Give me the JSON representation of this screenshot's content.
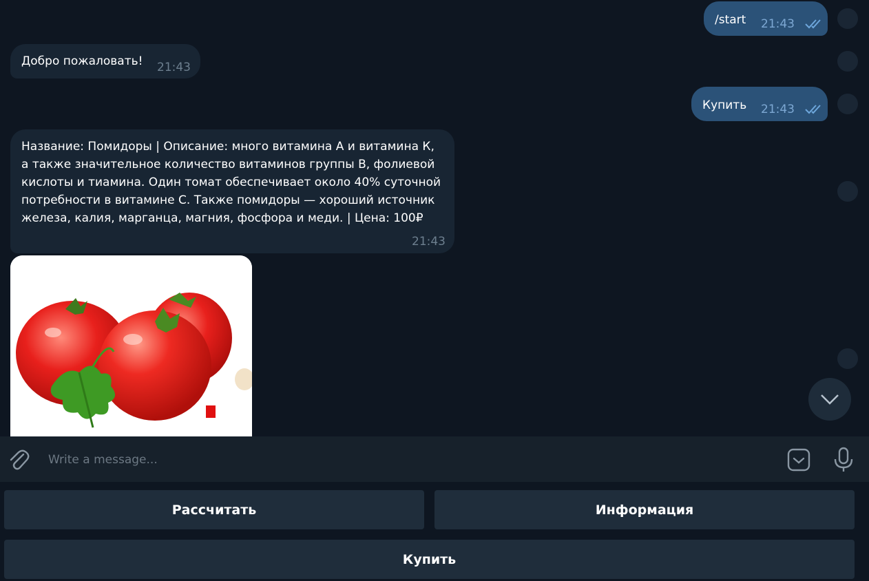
{
  "messages": [
    {
      "id": "start",
      "direction": "out",
      "text": "/start",
      "time": "21:43",
      "status": "read"
    },
    {
      "id": "welcome",
      "direction": "in",
      "text": "Добро пожаловать!",
      "time": "21:43"
    },
    {
      "id": "buy",
      "direction": "out",
      "text": "Купить",
      "time": "21:43",
      "status": "read"
    },
    {
      "id": "product",
      "direction": "in",
      "text": "Название: Помидоры | Описание: много витамина А и витамина К, а также значительное количество витаминов группы В, фолиевой кислоты и тиамина. Один томат обеспечивает около 40% суточной потребности в витамине С. Также помидоры — хороший источник железа, калия, марганца, магния, фосфора и меди. | Цена: 100₽",
      "time": "21:43"
    }
  ],
  "photo": {
    "subject": "tomatoes"
  },
  "input": {
    "placeholder": "Write a message..."
  },
  "keyboard": {
    "row1": [
      "Рассчитать",
      "Информация"
    ],
    "row2": [
      "Купить"
    ]
  },
  "icons": {
    "attach": "paperclip-icon",
    "sticker": "sticker-icon",
    "mic": "microphone-icon",
    "scroll": "chevron-down-icon",
    "read": "double-check-icon"
  },
  "colors": {
    "background": "#0e1621",
    "incoming_bubble": "#182533",
    "outgoing_bubble": "#2b5278",
    "input_bar": "#17212b",
    "keyboard_button": "#1f2d3b"
  }
}
